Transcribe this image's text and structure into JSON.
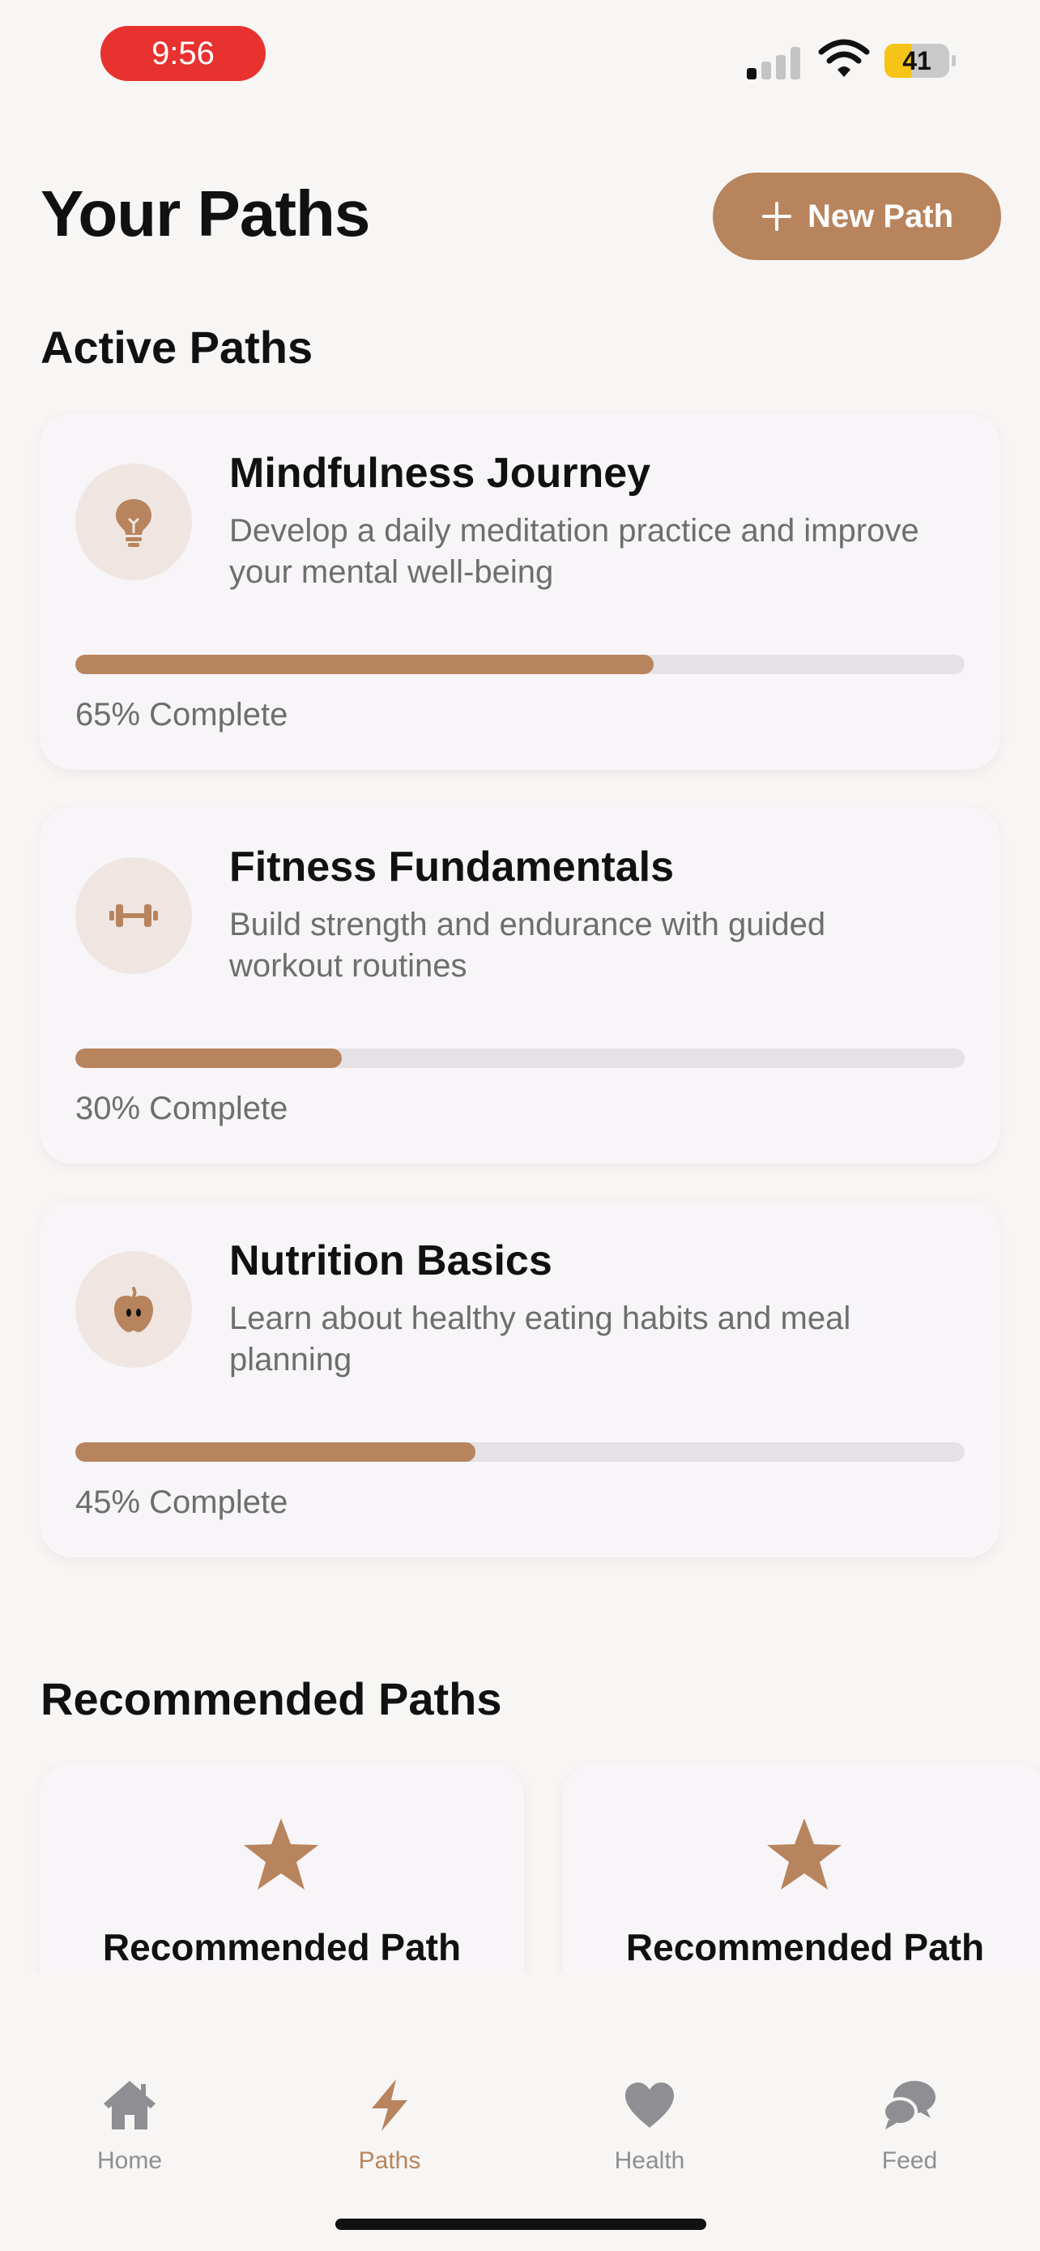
{
  "status_bar": {
    "time": "9:56",
    "battery": "41",
    "battery_level": 0.41
  },
  "header": {
    "title": "Your Paths",
    "new_path_label": "New Path"
  },
  "sections": {
    "active": "Active Paths",
    "recommended": "Recommended Paths"
  },
  "active_paths": [
    {
      "title": "Mindfulness Journey",
      "description": "Develop a daily meditation practice and improve your mental well-being",
      "progress": 0.65,
      "progress_label": "65% Complete",
      "icon": "lightbulb-icon"
    },
    {
      "title": "Fitness Fundamentals",
      "description": "Build strength and endurance with guided workout routines",
      "progress": 0.3,
      "progress_label": "30% Complete",
      "icon": "dumbbell-icon"
    },
    {
      "title": "Nutrition Basics",
      "description": "Learn about healthy eating habits and meal planning",
      "progress": 0.45,
      "progress_label": "45% Complete",
      "icon": "apple-icon"
    }
  ],
  "recommended_paths": [
    {
      "title": "Recommended Path",
      "icon": "star-icon"
    },
    {
      "title": "Recommended Path",
      "icon": "star-icon"
    }
  ],
  "tabs": [
    {
      "label": "Home",
      "icon": "house-icon",
      "active": false
    },
    {
      "label": "Paths",
      "icon": "bolt-icon",
      "active": true
    },
    {
      "label": "Health",
      "icon": "heart-icon",
      "active": false
    },
    {
      "label": "Feed",
      "icon": "chat-bubbles-icon",
      "active": false
    }
  ],
  "colors": {
    "accent": "#b8845d",
    "status_pill": "#e8322f",
    "tab_inactive": "#8e8e93",
    "background": "#f8f6f4"
  }
}
